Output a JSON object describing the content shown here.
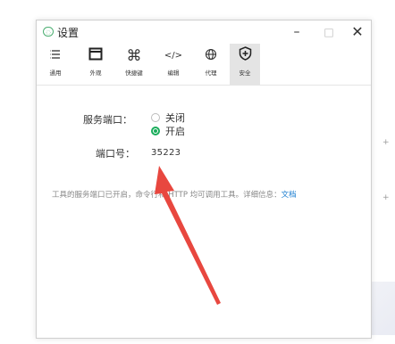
{
  "window": {
    "title": "设置",
    "controls": {
      "minimize": "–",
      "maximize": "□",
      "close": "✕"
    }
  },
  "toolbar": {
    "tabs": [
      {
        "label": "通用",
        "icon": "list-icon"
      },
      {
        "label": "外观",
        "icon": "layout-icon"
      },
      {
        "label": "快捷键",
        "icon": "command-key-icon"
      },
      {
        "label": "编辑",
        "icon": "code-icon"
      },
      {
        "label": "代理",
        "icon": "globe-icon"
      },
      {
        "label": "安全",
        "icon": "shield-plus-icon",
        "active": true
      }
    ]
  },
  "security": {
    "service_port_label": "服务端口：",
    "options": {
      "off": "关闭",
      "on": "开启",
      "selected": "on"
    },
    "port_number_label": "端口号：",
    "port_value": "35223",
    "info_text": "工具的服务端口已开启，命令行和 HTTP 均可调用工具。详细信息：",
    "info_link": "文档"
  },
  "page": {
    "edge_marks": [
      "+",
      "+"
    ]
  },
  "annotation": {
    "arrow_color": "#e8473f"
  }
}
